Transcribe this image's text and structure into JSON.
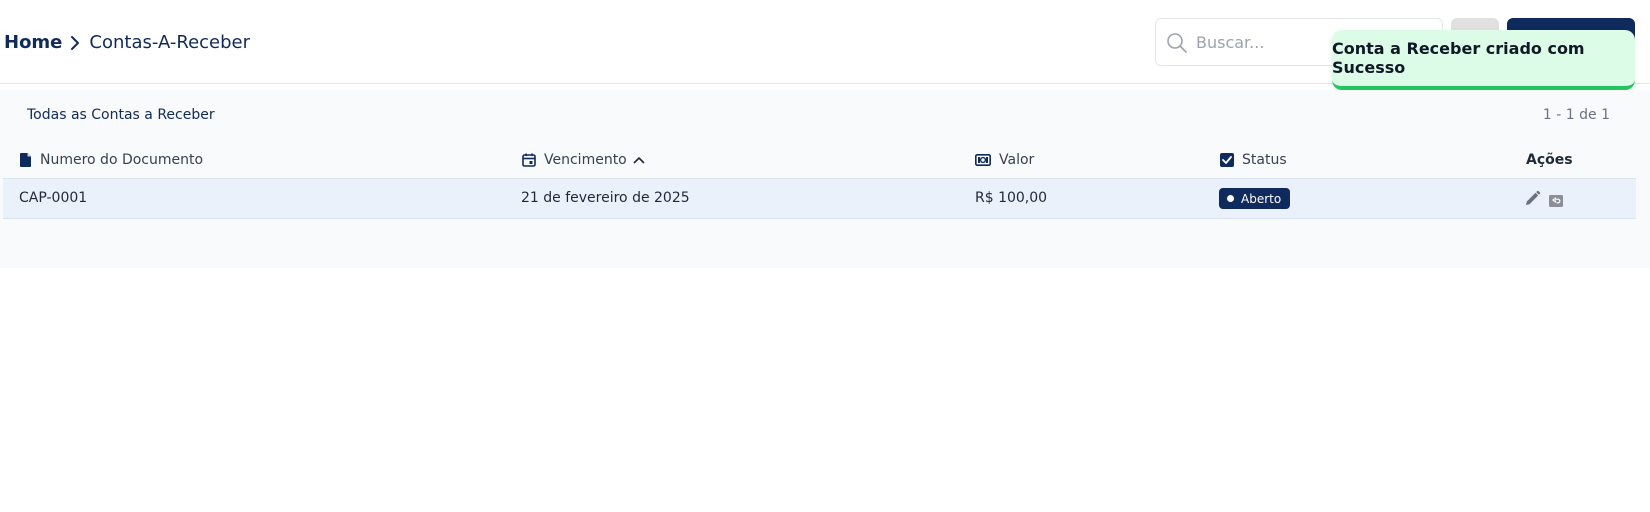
{
  "breadcrumb": {
    "home": "Home",
    "current": "Contas-A-Receber"
  },
  "search": {
    "placeholder": "Buscar...",
    "value": ""
  },
  "toast": {
    "message": "Conta a Receber criado com Sucesso"
  },
  "panel": {
    "title": "Todas as Contas a Receber",
    "pagination": "1 - 1 de 1"
  },
  "table": {
    "columns": {
      "documento": "Numero do Documento",
      "vencimento": "Vencimento",
      "valor": "Valor",
      "status": "Status",
      "acoes": "Ações"
    },
    "rows": [
      {
        "documento": "CAP-0001",
        "vencimento": "21 de fevereiro de 2025",
        "valor": "R$ 100,00",
        "status": "Aberto"
      }
    ]
  },
  "icons": {
    "header_documento": "file-icon",
    "header_vencimento": "calendar-icon",
    "header_valor": "money-icon",
    "header_status": "checkbox-icon",
    "sort": "chevron-up-icon",
    "edit": "pencil-icon",
    "undo": "reply-icon",
    "search": "search-icon"
  },
  "colors": {
    "primary": "#0f2a5c",
    "success_bg": "#dcfce7",
    "success_border": "#22c55e",
    "row_bg": "#ebf1fa"
  }
}
